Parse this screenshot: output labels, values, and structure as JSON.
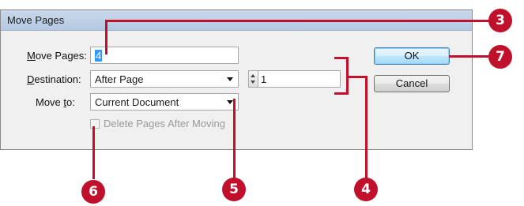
{
  "dialog": {
    "title": "Move Pages",
    "move_pages": {
      "label_prefix": "",
      "label_ul": "M",
      "label_rest": "ove Pages:",
      "value": "4"
    },
    "destination": {
      "label_ul": "D",
      "label_rest": "estination:",
      "value": "After Page",
      "page_value": "1"
    },
    "move_to": {
      "label_pre": "Move ",
      "label_ul": "t",
      "label_rest": "o:",
      "value": "Current Document"
    },
    "delete_checkbox": {
      "label": "Delete Pages After Moving",
      "checked": false,
      "enabled": false
    },
    "ok_label": "OK",
    "cancel_label": "Cancel"
  },
  "callouts": {
    "c3": "3",
    "c4": "4",
    "c5": "5",
    "c6": "6",
    "c7": "7"
  },
  "colors": {
    "callout": "#c0102b",
    "selection": "#3399ff"
  }
}
